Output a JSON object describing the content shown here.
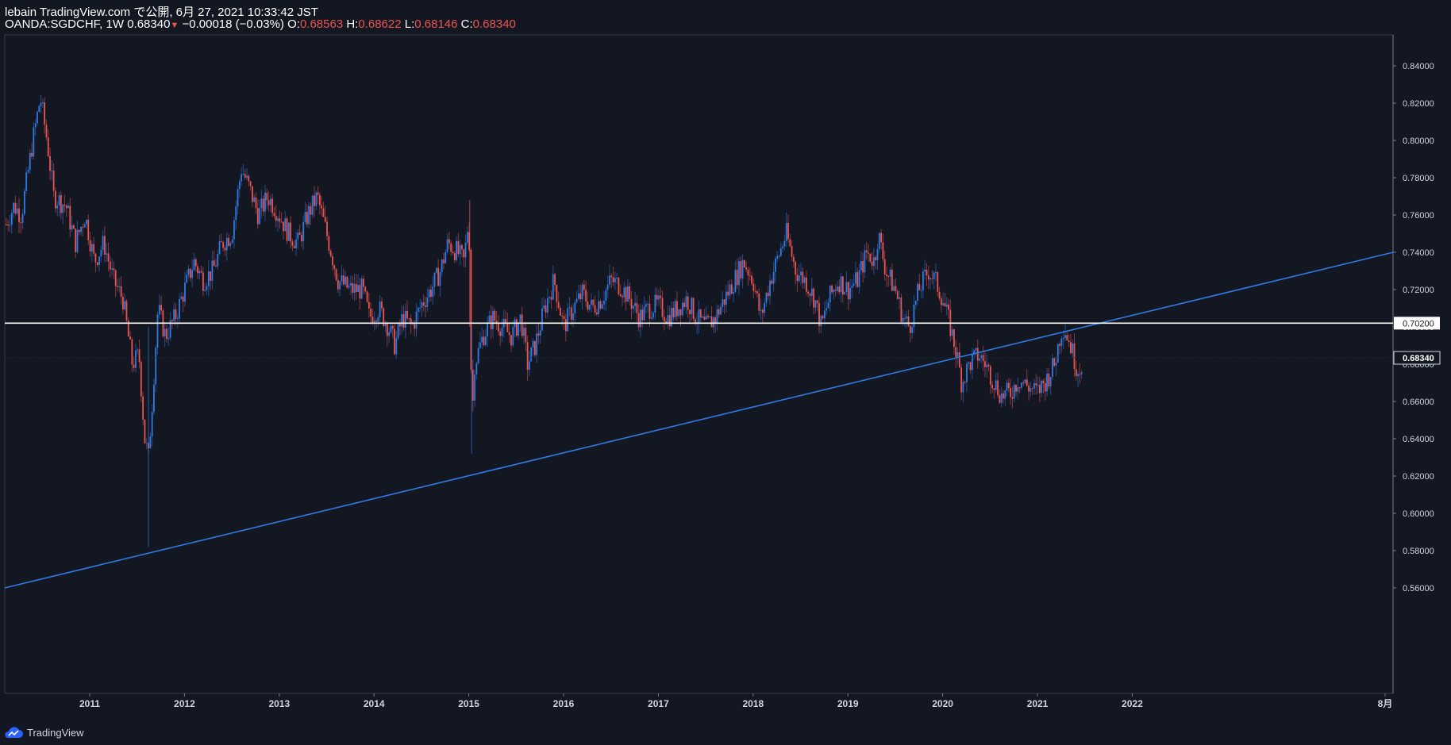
{
  "header": {
    "line1": "lebain TradingView.com で公開, 6月 27, 2021 10:33:42 JST",
    "symbol": "OANDA:SGDCHF, 1W",
    "last": "0.68340",
    "change": "−0.00018 (−0.03%)",
    "o_label": "O:",
    "o": "0.68563",
    "h_label": "H:",
    "h": "0.68622",
    "l_label": "L:",
    "l": "0.68146",
    "c_label": "C:",
    "c": "0.68340"
  },
  "footer": {
    "brand": "TradingView",
    "logo_icon": "tradingview-cloud-icon"
  },
  "colors": {
    "bg": "#131722",
    "up": "#2f7ae5",
    "down": "#ef5350",
    "trend": "#2f7ae5",
    "hline": "#ffffff",
    "axis": "#787b86"
  },
  "chart_data": {
    "type": "candlestick",
    "interval": "1W",
    "x_ticks": [
      "2011",
      "2012",
      "2013",
      "2014",
      "2015",
      "2016",
      "2017",
      "2018",
      "2019",
      "2020",
      "2021",
      "2022",
      "8月"
    ],
    "y_ticks": [
      "0.56000",
      "0.58000",
      "0.60000",
      "0.62000",
      "0.64000",
      "0.66000",
      "0.68000",
      "0.70000",
      "0.72000",
      "0.74000",
      "0.76000",
      "0.78000",
      "0.80000",
      "0.82000",
      "0.84000"
    ],
    "ylim": [
      0.555,
      0.85
    ],
    "xlim": [
      2010.12,
      2022.6
    ],
    "price_path": [
      [
        2010.12,
        0.755
      ],
      [
        2010.2,
        0.765
      ],
      [
        2010.28,
        0.76
      ],
      [
        2010.4,
        0.8
      ],
      [
        2010.48,
        0.823
      ],
      [
        2010.55,
        0.8
      ],
      [
        2010.62,
        0.77
      ],
      [
        2010.75,
        0.765
      ],
      [
        2010.85,
        0.745
      ],
      [
        2010.95,
        0.76
      ],
      [
        2011.05,
        0.735
      ],
      [
        2011.15,
        0.745
      ],
      [
        2011.25,
        0.725
      ],
      [
        2011.35,
        0.715
      ],
      [
        2011.45,
        0.68
      ],
      [
        2011.52,
        0.685
      ],
      [
        2011.58,
        0.64
      ],
      [
        2011.62,
        0.63
      ],
      [
        2011.66,
        0.66
      ],
      [
        2011.72,
        0.71
      ],
      [
        2011.8,
        0.695
      ],
      [
        2011.9,
        0.705
      ],
      [
        2012.0,
        0.72
      ],
      [
        2012.1,
        0.735
      ],
      [
        2012.2,
        0.725
      ],
      [
        2012.3,
        0.73
      ],
      [
        2012.4,
        0.745
      ],
      [
        2012.5,
        0.75
      ],
      [
        2012.6,
        0.785
      ],
      [
        2012.68,
        0.775
      ],
      [
        2012.78,
        0.76
      ],
      [
        2012.88,
        0.77
      ],
      [
        2013.0,
        0.76
      ],
      [
        2013.1,
        0.75
      ],
      [
        2013.2,
        0.745
      ],
      [
        2013.3,
        0.76
      ],
      [
        2013.4,
        0.77
      ],
      [
        2013.5,
        0.75
      ],
      [
        2013.62,
        0.725
      ],
      [
        2013.75,
        0.72
      ],
      [
        2013.88,
        0.72
      ],
      [
        2013.95,
        0.705
      ],
      [
        2014.05,
        0.71
      ],
      [
        2014.15,
        0.7
      ],
      [
        2014.22,
        0.69
      ],
      [
        2014.3,
        0.705
      ],
      [
        2014.4,
        0.7
      ],
      [
        2014.5,
        0.712
      ],
      [
        2014.6,
        0.72
      ],
      [
        2014.7,
        0.73
      ],
      [
        2014.78,
        0.745
      ],
      [
        2014.88,
        0.74
      ],
      [
        2014.95,
        0.735
      ],
      [
        2015.0,
        0.76
      ],
      [
        2015.02,
        0.7
      ],
      [
        2015.03,
        0.645
      ],
      [
        2015.06,
        0.68
      ],
      [
        2015.15,
        0.695
      ],
      [
        2015.25,
        0.705
      ],
      [
        2015.35,
        0.7
      ],
      [
        2015.45,
        0.695
      ],
      [
        2015.55,
        0.705
      ],
      [
        2015.62,
        0.68
      ],
      [
        2015.7,
        0.69
      ],
      [
        2015.8,
        0.71
      ],
      [
        2015.9,
        0.725
      ],
      [
        2016.0,
        0.7
      ],
      [
        2016.1,
        0.71
      ],
      [
        2016.2,
        0.718
      ],
      [
        2016.3,
        0.71
      ],
      [
        2016.4,
        0.715
      ],
      [
        2016.5,
        0.725
      ],
      [
        2016.6,
        0.722
      ],
      [
        2016.7,
        0.715
      ],
      [
        2016.8,
        0.705
      ],
      [
        2016.9,
        0.71
      ],
      [
        2017.0,
        0.712
      ],
      [
        2017.1,
        0.705
      ],
      [
        2017.2,
        0.71
      ],
      [
        2017.3,
        0.715
      ],
      [
        2017.4,
        0.705
      ],
      [
        2017.5,
        0.7
      ],
      [
        2017.6,
        0.705
      ],
      [
        2017.7,
        0.715
      ],
      [
        2017.8,
        0.725
      ],
      [
        2017.9,
        0.735
      ],
      [
        2018.0,
        0.725
      ],
      [
        2018.08,
        0.705
      ],
      [
        2018.18,
        0.725
      ],
      [
        2018.28,
        0.74
      ],
      [
        2018.35,
        0.75
      ],
      [
        2018.45,
        0.73
      ],
      [
        2018.55,
        0.725
      ],
      [
        2018.65,
        0.715
      ],
      [
        2018.72,
        0.7
      ],
      [
        2018.8,
        0.715
      ],
      [
        2018.9,
        0.725
      ],
      [
        2019.0,
        0.72
      ],
      [
        2019.1,
        0.725
      ],
      [
        2019.2,
        0.74
      ],
      [
        2019.28,
        0.735
      ],
      [
        2019.32,
        0.75
      ],
      [
        2019.4,
        0.73
      ],
      [
        2019.5,
        0.72
      ],
      [
        2019.58,
        0.705
      ],
      [
        2019.65,
        0.7
      ],
      [
        2019.75,
        0.72
      ],
      [
        2019.85,
        0.73
      ],
      [
        2019.92,
        0.725
      ],
      [
        2020.0,
        0.715
      ],
      [
        2020.08,
        0.7
      ],
      [
        2020.15,
        0.685
      ],
      [
        2020.2,
        0.67
      ],
      [
        2020.28,
        0.68
      ],
      [
        2020.38,
        0.685
      ],
      [
        2020.45,
        0.68
      ],
      [
        2020.55,
        0.67
      ],
      [
        2020.62,
        0.663
      ],
      [
        2020.72,
        0.665
      ],
      [
        2020.8,
        0.672
      ],
      [
        2020.9,
        0.668
      ],
      [
        2021.0,
        0.665
      ],
      [
        2021.1,
        0.672
      ],
      [
        2021.18,
        0.68
      ],
      [
        2021.25,
        0.698
      ],
      [
        2021.28,
        0.7
      ],
      [
        2021.35,
        0.69
      ],
      [
        2021.42,
        0.677
      ],
      [
        2021.48,
        0.681
      ],
      [
        2021.48,
        0.6834
      ]
    ],
    "spikes": [
      [
        2011.62,
        0.582
      ],
      [
        2015.03,
        0.632
      ],
      [
        2015.01,
        0.768
      ]
    ],
    "horizontal_line": {
      "value": 0.702,
      "label": "0.70200"
    },
    "trendline": {
      "from": [
        2010.12,
        0.56
      ],
      "to": [
        2022.6,
        0.74
      ]
    },
    "last_price": {
      "value": 0.6834,
      "label": "0.68340"
    }
  }
}
